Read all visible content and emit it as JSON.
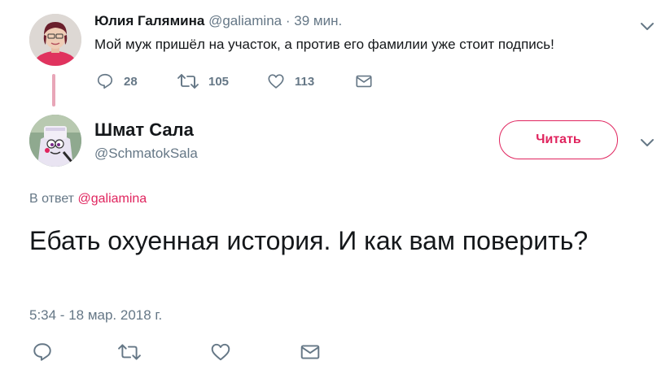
{
  "parent_tweet": {
    "author_name": "Юлия Галямина",
    "author_handle": "@galiamina",
    "separator": "·",
    "time": "39 мин.",
    "text": "Мой муж пришёл на участок, а против его фамилии уже стоит подпись!",
    "reply_count": "28",
    "retweet_count": "105",
    "like_count": "113"
  },
  "main_tweet": {
    "author_name": "Шмат Сала",
    "author_handle": "@SchmatokSala",
    "follow_label": "Читать",
    "reply_prefix": "В ответ",
    "reply_handle": "@galiamina",
    "text": "Ебать охуенная история. И как вам поверить?",
    "timestamp": "5:34 - 18 мар. 2018 г."
  },
  "colors": {
    "accent": "#e0245e",
    "muted": "#657786",
    "text": "#14171a",
    "thread_line": "#e8a6b8"
  },
  "icons": [
    "reply-icon",
    "retweet-icon",
    "like-icon",
    "direct-message-icon",
    "chevron-down-icon"
  ]
}
